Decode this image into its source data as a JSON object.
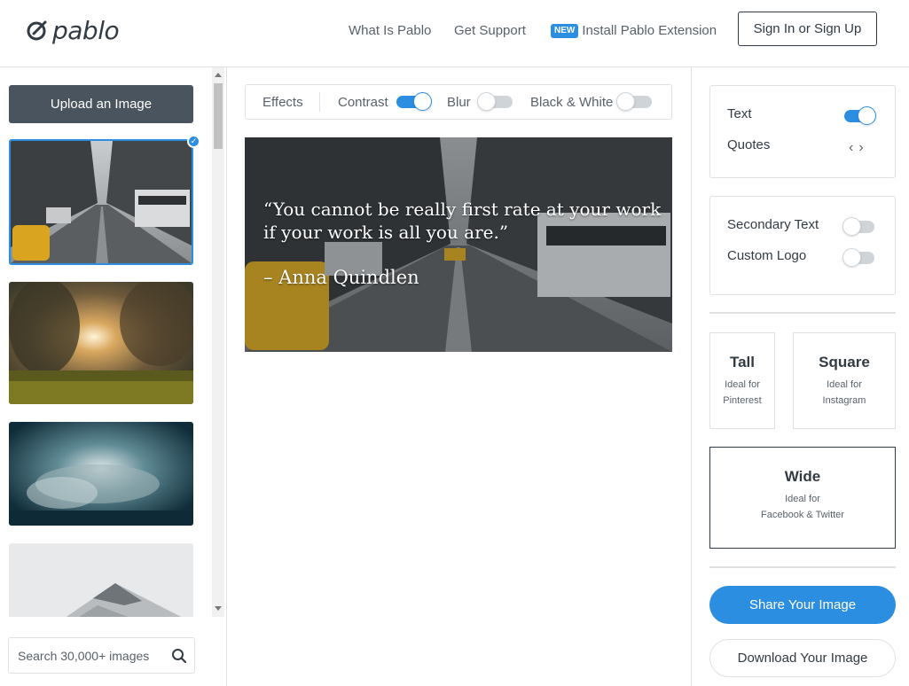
{
  "header": {
    "logo_text": "pablo",
    "nav": {
      "what_is": "What Is Pablo",
      "support": "Get Support",
      "new_badge": "NEW",
      "extension": "Install Pablo Extension"
    },
    "signin_label": "Sign In or Sign Up"
  },
  "left": {
    "upload_label": "Upload an Image",
    "search_placeholder": "Search 30,000+ images"
  },
  "effects": {
    "title": "Effects",
    "contrast": {
      "label": "Contrast",
      "on": true
    },
    "blur": {
      "label": "Blur",
      "on": false
    },
    "bw": {
      "label": "Black & White",
      "on": false
    }
  },
  "canvas": {
    "quote": "“You cannot be really first rate at your work if your work is all you are.”",
    "author": "– Anna Quindlen"
  },
  "right": {
    "text": {
      "label": "Text",
      "on": true
    },
    "quotes_label": "Quotes",
    "secondary_text": {
      "label": "Secondary Text",
      "on": false
    },
    "custom_logo": {
      "label": "Custom Logo",
      "on": false
    },
    "sizes": {
      "tall": {
        "title": "Tall",
        "line1": "Ideal for",
        "line2": "Pinterest"
      },
      "square": {
        "title": "Square",
        "line1": "Ideal for",
        "line2": "Instagram"
      },
      "wide": {
        "title": "Wide",
        "line1": "Ideal for",
        "line2": "Facebook & Twitter"
      }
    },
    "share_label": "Share Your Image",
    "download_label": "Download Your Image"
  },
  "colors": {
    "accent": "#2c8ee0",
    "dark": "#323b43",
    "upload_bg": "#4a545e"
  }
}
